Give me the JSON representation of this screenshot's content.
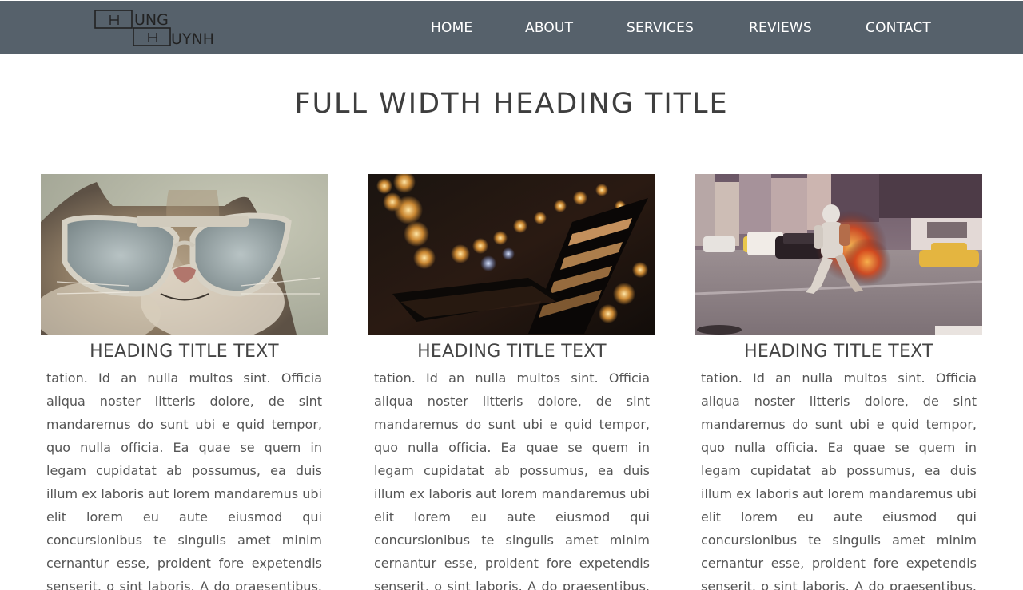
{
  "logo": {
    "line1": "UNG",
    "line2": "UYNH",
    "alt": "Hung Huynh"
  },
  "nav": {
    "items": [
      {
        "label": "HOME"
      },
      {
        "label": "ABOUT"
      },
      {
        "label": "SERVICES"
      },
      {
        "label": "REVIEWS"
      },
      {
        "label": "CONTACT"
      }
    ]
  },
  "main": {
    "title": "FULL WIDTH HEADING TITLE",
    "cards": [
      {
        "image": "cat-with-glasses-photo",
        "heading": "HEADING TITLE TEXT",
        "text": "tation. Id an nulla multos sint. Officia aliqua noster litteris dolore, de sint mandaremus do sunt ubi e quid tempor, quo nulla officia. Ea quae se quem in legam cupidatat ab possumus, ea duis illum ex laboris aut lorem mandaremus ubi elit lorem eu aute eiusmod qui concursionibus te singulis amet minim cernantur esse, proident fore expetendis senserit, o sint laboris. A do praesentibus. Est quorum philosophari, an dolore ne lorem. Ne"
      },
      {
        "image": "night-bench-bokeh-photo",
        "heading": "HEADING TITLE TEXT",
        "text": "tation. Id an nulla multos sint. Officia aliqua noster litteris dolore, de sint mandaremus do sunt ubi e quid tempor, quo nulla officia. Ea quae se quem in legam cupidatat ab possumus, ea duis illum ex laboris aut lorem mandaremus ubi elit lorem eu aute eiusmod qui concursionibus te singulis amet minim cernantur esse, proident fore expetendis senserit, o sint laboris. A do praesentibus. Est quorum philosophari, an dolore ne lorem. Ne"
      },
      {
        "image": "astronaut-city-street-photo",
        "heading": "HEADING TITLE TEXT",
        "text": "tation. Id an nulla multos sint. Officia aliqua noster litteris dolore, de sint mandaremus do sunt ubi e quid tempor, quo nulla officia. Ea quae se quem in legam cupidatat ab possumus, ea duis illum ex laboris aut lorem mandaremus ubi elit lorem eu aute eiusmod qui concursionibus te singulis amet minim cernantur esse, proident fore expetendis senserit, o sint laboris. A do praesentibus. Est quorum philosophari, an dolore ne lorem. Ne"
      }
    ]
  },
  "colors": {
    "navbar": "#56616b",
    "nav_text": "#ffffff",
    "title_text": "#3e3e3e",
    "body_text": "#555555"
  }
}
